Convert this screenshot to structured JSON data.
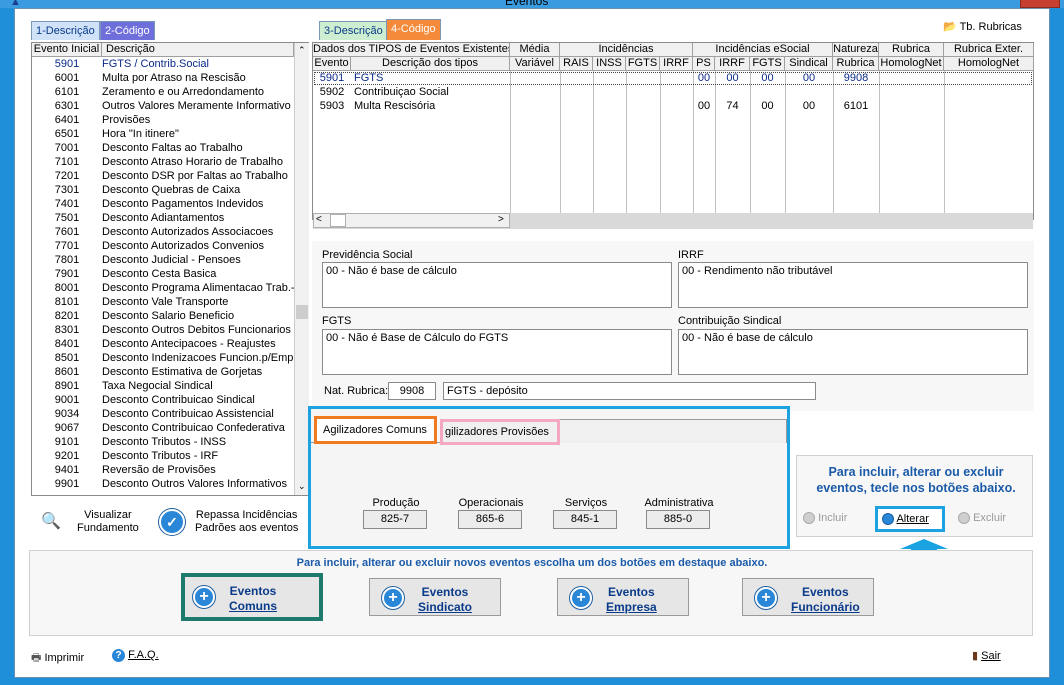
{
  "window": {
    "title": "Eventos"
  },
  "left_tabs": [
    "1-Descrição",
    "2-Código"
  ],
  "right_tabs": [
    "3-Descrição",
    "4-Código"
  ],
  "tb_rubricas": "Tb. Rubricas",
  "event_list": {
    "headers": [
      "Evento Inicial",
      "Descrição"
    ],
    "rows": [
      [
        "5901",
        "FGTS / Contrib.Social"
      ],
      [
        "6001",
        "Multa por Atraso na Rescisão"
      ],
      [
        "6101",
        "Zeramento e ou Arredondamento"
      ],
      [
        "6301",
        "Outros Valores Meramente Informativo"
      ],
      [
        "6401",
        "Provisões"
      ],
      [
        "6501",
        "Hora \"In itinere\""
      ],
      [
        "7001",
        "Desconto Faltas ao Trabalho"
      ],
      [
        "7101",
        "Desconto Atraso Horario de Trabalho"
      ],
      [
        "7201",
        "Desconto DSR por Faltas ao Trabalho"
      ],
      [
        "7301",
        "Desconto Quebras de Caixa"
      ],
      [
        "7401",
        "Desconto Pagamentos Indevidos"
      ],
      [
        "7501",
        "Desconto Adiantamentos"
      ],
      [
        "7601",
        "Desconto Autorizados Associacoes"
      ],
      [
        "7701",
        "Desconto Autorizados Convenios"
      ],
      [
        "7801",
        "Desconto Judicial - Pensoes"
      ],
      [
        "7901",
        "Desconto Cesta Basica"
      ],
      [
        "8001",
        "Desconto Programa Alimentacao Trab.-"
      ],
      [
        "8101",
        "Desconto Vale Transporte"
      ],
      [
        "8201",
        "Desconto Salario Beneficio"
      ],
      [
        "8301",
        "Desconto Outros Debitos Funcionarios"
      ],
      [
        "8401",
        "Desconto Antecipacoes - Reajustes"
      ],
      [
        "8501",
        "Desconto Indenizacoes Funcion.p/Emp"
      ],
      [
        "8601",
        "Desconto Estimativa de Gorjetas"
      ],
      [
        "8901",
        "Taxa Negocial Sindical"
      ],
      [
        "9001",
        "Desconto Contribuicao Sindical"
      ],
      [
        "9034",
        "Desconto Contribuicao Assistencial"
      ],
      [
        "9067",
        "Desconto Contribuicao Confederativa"
      ],
      [
        "9101",
        "Desconto Tributos - INSS"
      ],
      [
        "9201",
        "Desconto Tributos - IRF"
      ],
      [
        "9401",
        "Reversão de Provisões"
      ],
      [
        "9901",
        "Desconto Outros Valores Informativos"
      ]
    ]
  },
  "types_grid": {
    "group_headers": [
      "Dados dos TIPOS de Eventos Existentes",
      "Média",
      "Incidências",
      "Incidências eSocial",
      "Natureza",
      "Rubrica",
      "Rubrica Exter."
    ],
    "sub_headers": [
      "Evento",
      "Descrição dos tipos",
      "Variável",
      "RAIS",
      "INSS",
      "FGTS",
      "IRRF",
      "PS",
      "IRRF",
      "FGTS",
      "Sindical",
      "Rubrica",
      "HomologNet",
      "HomologNet"
    ],
    "rows": [
      {
        "evento": "5901",
        "desc": "FGTS",
        "ps": "00",
        "irrf": "00",
        "fgts": "00",
        "sind": "00",
        "rubrica": "9908"
      },
      {
        "evento": "5902",
        "desc": "Contribuiçao Social",
        "ps": "",
        "irrf": "",
        "fgts": "",
        "sind": "",
        "rubrica": ""
      },
      {
        "evento": "5903",
        "desc": "Multa Rescisória",
        "ps": "00",
        "irrf": "74",
        "fgts": "00",
        "sind": "00",
        "rubrica": "6101"
      }
    ]
  },
  "details": {
    "prev_label": "Previdência Social",
    "prev_value": "00 - Não é base de cálculo",
    "irrf_label": "IRRF",
    "irrf_value": "00 - Rendimento não tributável",
    "fgts_label": "FGTS",
    "fgts_value": "00 - Não é Base de Cálculo do FGTS",
    "sind_label": "Contribuição Sindical",
    "sind_value": "00 - Não é base de cálculo",
    "nat_label": "Nat. Rubrica:",
    "nat_code": "9908",
    "nat_desc": "FGTS - depósito"
  },
  "agilizadores": {
    "tabs": [
      "Agilizadores Comuns",
      "gilizadores Provisões"
    ],
    "items": [
      {
        "label": "Produção",
        "value": "825-7"
      },
      {
        "label": "Operacionais",
        "value": "865-6"
      },
      {
        "label": "Serviços",
        "value": "845-1"
      },
      {
        "label": "Administrativa",
        "value": "885-0"
      }
    ]
  },
  "hint_box": {
    "text": "Para incluir, alterar ou excluir eventos, tecle nos botões abaixo.",
    "incluir": "Incluir",
    "alterar": "Alterar",
    "excluir": "Excluir"
  },
  "left_actions": {
    "visualizar": "Visualizar",
    "fundamento": "Fundamento",
    "repassa1": "Repassa Incidências",
    "repassa2": "Padrões aos eventos"
  },
  "bottom": {
    "hint": "Para incluir, alterar ou excluir novos eventos escolha um dos botões em destaque abaixo.",
    "buttons": [
      {
        "l1": "Eventos",
        "l2": "Comuns"
      },
      {
        "l1": "Eventos",
        "l2": "Sindicato"
      },
      {
        "l1": "Eventos",
        "l2": "Empresa"
      },
      {
        "l1": "Eventos",
        "l2": "Funcionário"
      }
    ]
  },
  "footer": {
    "imprimir": "Imprimir",
    "faq": "F.A.Q.",
    "sair": "Sair"
  },
  "colors": {
    "highlight_blue": "#1aa3e0",
    "highlight_orange": "#f07a20",
    "highlight_pink": "#f5a6c0",
    "highlight_teal": "#1e7a6a"
  }
}
